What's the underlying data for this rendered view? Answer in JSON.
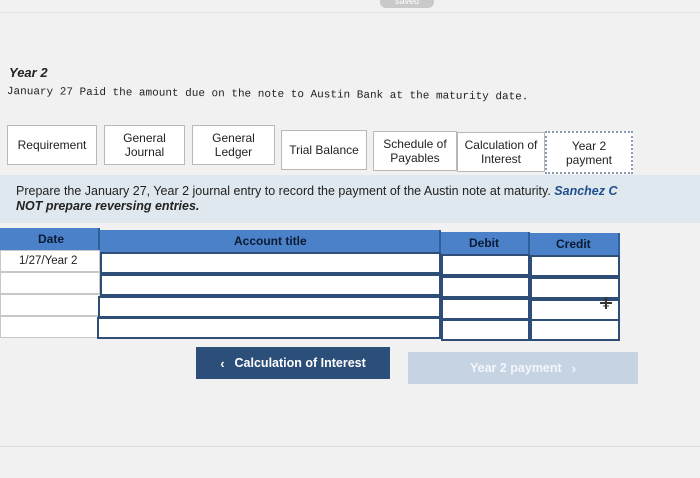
{
  "status": {
    "saved": "saved"
  },
  "header": {
    "year": "Year 2",
    "transaction": "January 27 Paid the amount due on the note to Austin Bank at the maturity date."
  },
  "tabs": [
    {
      "label": "Requirement"
    },
    {
      "label": "General\nJournal"
    },
    {
      "label": "General\nLedger"
    },
    {
      "label": "Trial Balance"
    },
    {
      "label": "Schedule of\nPayables"
    },
    {
      "label": "Calculation of\nInterest"
    },
    {
      "label": "Year 2\npayment",
      "active": true
    }
  ],
  "instruction": {
    "text": "Prepare the January 27, Year 2 journal entry to record the payment of the Austin note at maturity.",
    "emphasis": "Sanchez C",
    "line2": "NOT prepare reversing entries."
  },
  "journal": {
    "columns": {
      "date": "Date",
      "account": "Account title",
      "debit": "Debit",
      "credit": "Credit"
    },
    "rows": [
      {
        "date": "1/27/Year 2",
        "account": "",
        "debit": "",
        "credit": ""
      },
      {
        "date": "",
        "account": "",
        "debit": "",
        "credit": ""
      },
      {
        "date": "",
        "account": "",
        "debit": "",
        "credit": ""
      },
      {
        "date": "",
        "account": "",
        "debit": "",
        "credit": ""
      }
    ]
  },
  "navigation": {
    "prev_label": "Calculation of Interest",
    "next_label": "Year 2 payment"
  },
  "colors": {
    "header_blue": "#4b81c8",
    "button_navy": "#2c4f7a",
    "button_disabled": "#c5d3e3",
    "emphasis": "#1f4f8e"
  },
  "icons": {
    "prev": "chevron-left-icon",
    "next": "chevron-right-icon",
    "add": "plus-icon"
  }
}
